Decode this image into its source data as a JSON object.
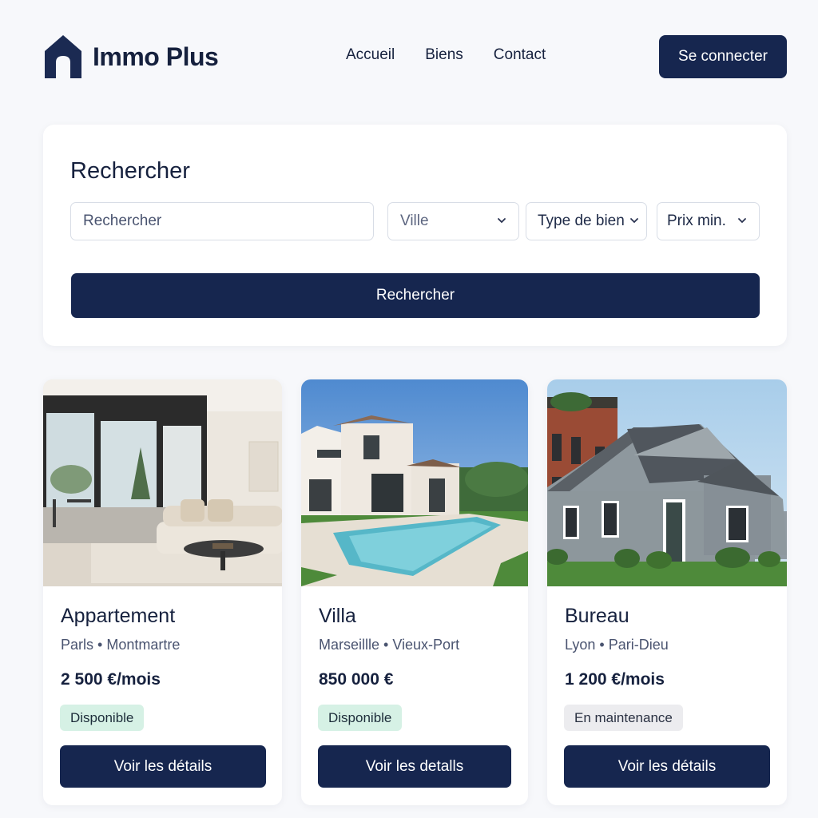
{
  "header": {
    "logo_text": "Immo Plus",
    "logo_icon": "house-icon",
    "nav": [
      "Accueil",
      "Biens",
      "Contact"
    ],
    "login_label": "Se connecter"
  },
  "search": {
    "title": "Rechercher",
    "input_placeholder": "Rechercher",
    "selects": [
      "Ville",
      "Type de bien",
      "Prix min."
    ],
    "button_label": "Rechercher"
  },
  "listings": [
    {
      "type": "Appartement",
      "city": "Parls",
      "district": "Montmartre",
      "price": "2 500 €/mois",
      "status": "Disponible",
      "button": "Voir les détails"
    },
    {
      "type": "Villa",
      "city": "Marseillle",
      "district": "Vieux-Port",
      "price": "850 000 €",
      "status": "Disponible",
      "button": "Voir les detalls"
    },
    {
      "type": "Bureau",
      "city": "Lyon",
      "district": "Pari-Dieu",
      "price": "1 200 €/mois",
      "status": "En maintenance",
      "button": "Voir les détails"
    }
  ],
  "colors": {
    "primary": "#16264f",
    "background": "#f7f8fb",
    "available_badge": "#d6f1e5",
    "maintenance_badge": "#ececef"
  }
}
